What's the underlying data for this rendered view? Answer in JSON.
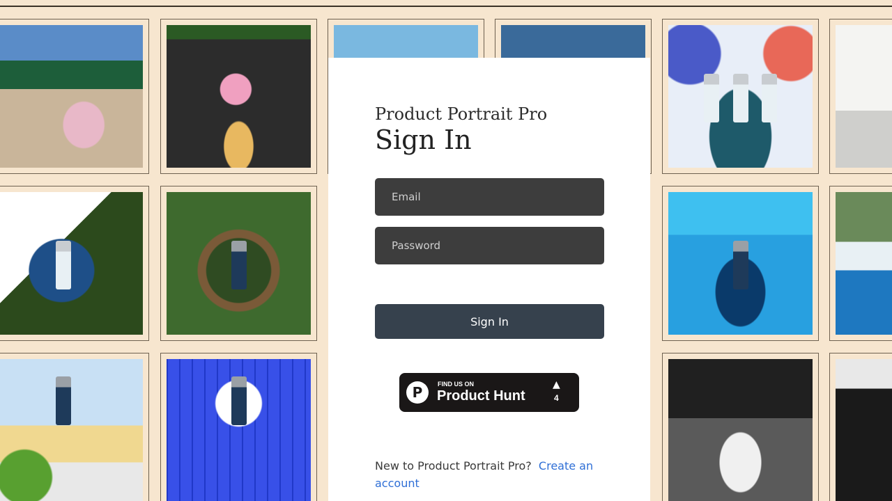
{
  "app": {
    "name": "Product Portrait Pro"
  },
  "signin": {
    "title": "Sign In",
    "email_placeholder": "Email",
    "password_placeholder": "Password",
    "submit_label": "Sign In"
  },
  "product_hunt": {
    "small_text": "FIND US ON",
    "big_text": "Product Hunt",
    "logo_letter": "P",
    "arrow": "▲",
    "upvotes": "4"
  },
  "footer": {
    "prompt": "New to Product Portrait Pro?",
    "link_label": "Create an account"
  },
  "colors": {
    "background": "#f7e6cf",
    "field": "#3d3d3d",
    "button": "#36414d",
    "link": "#2f6fd6"
  },
  "gallery": {
    "images": [
      "ice-cream-beach",
      "ice-cream-sand",
      "ice-cream-beach-2",
      "dark-sea",
      "serum-bottles-flowers",
      "daisies-vase",
      "serum-in-basket",
      "serum-wreath-leaves",
      "serum-water-pedestal",
      "succulent-water",
      "serum-sunny-beach",
      "serum-blue-grid",
      "teacups-bw",
      "bw-interior"
    ]
  }
}
